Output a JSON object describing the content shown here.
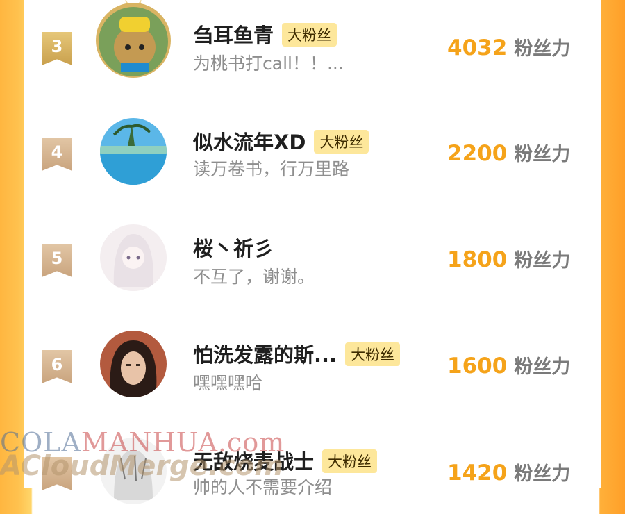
{
  "fans": [
    {
      "rank": "3",
      "name": "刍耳鱼青",
      "badge": "大粉丝",
      "desc": "为桃书打call！！...",
      "score": "4032",
      "unit": "粉丝力"
    },
    {
      "rank": "4",
      "name": "似水流年XD",
      "badge": "大粉丝",
      "desc": "读万卷书，行万里路",
      "score": "2200",
      "unit": "粉丝力"
    },
    {
      "rank": "5",
      "name": "桜丶祈彡",
      "badge": "",
      "desc": "不互了，谢谢。",
      "score": "1800",
      "unit": "粉丝力"
    },
    {
      "rank": "6",
      "name": "怕洗发露的斯...",
      "badge": "大粉丝",
      "desc": "嘿嘿嘿哈",
      "score": "1600",
      "unit": "粉丝力"
    },
    {
      "rank": "",
      "name": "无敌烧麦战士",
      "badge": "大粉丝",
      "desc": "帅的人不需要介绍",
      "score": "1420",
      "unit": "粉丝力"
    }
  ],
  "watermark": {
    "line1_a": "COLA",
    "line1_b": "MANHUA",
    "line1_c": ".com",
    "line2": "ACloudMerge.com"
  },
  "colors": {
    "score": "#f5a31a",
    "badge_bg": "#fde79b",
    "side_gradient": "#ffb03a"
  }
}
